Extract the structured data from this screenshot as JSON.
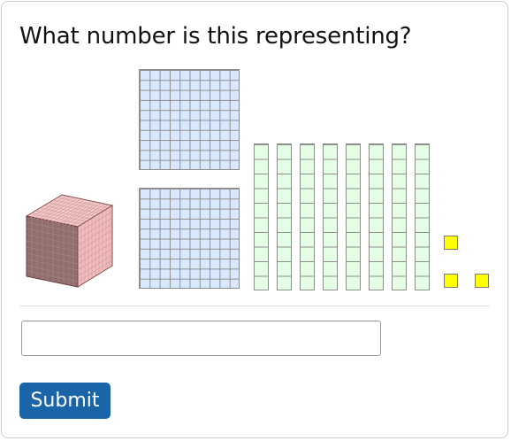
{
  "question": {
    "text": "What number is this representing?"
  },
  "base_ten_blocks": {
    "thousands_cubes": 1,
    "hundreds_flats": 2,
    "tens_rods": 8,
    "ones_units": 3,
    "colors": {
      "cube": "#f2b6b6",
      "flat": "#d8e8ff",
      "rod": "#e4fde4",
      "unit": "#ffff00",
      "grid_line": "#8e8e8e"
    }
  },
  "answer_field": {
    "value": "",
    "placeholder": ""
  },
  "submit_button": {
    "label": "Submit",
    "color": "#1a64a8"
  }
}
